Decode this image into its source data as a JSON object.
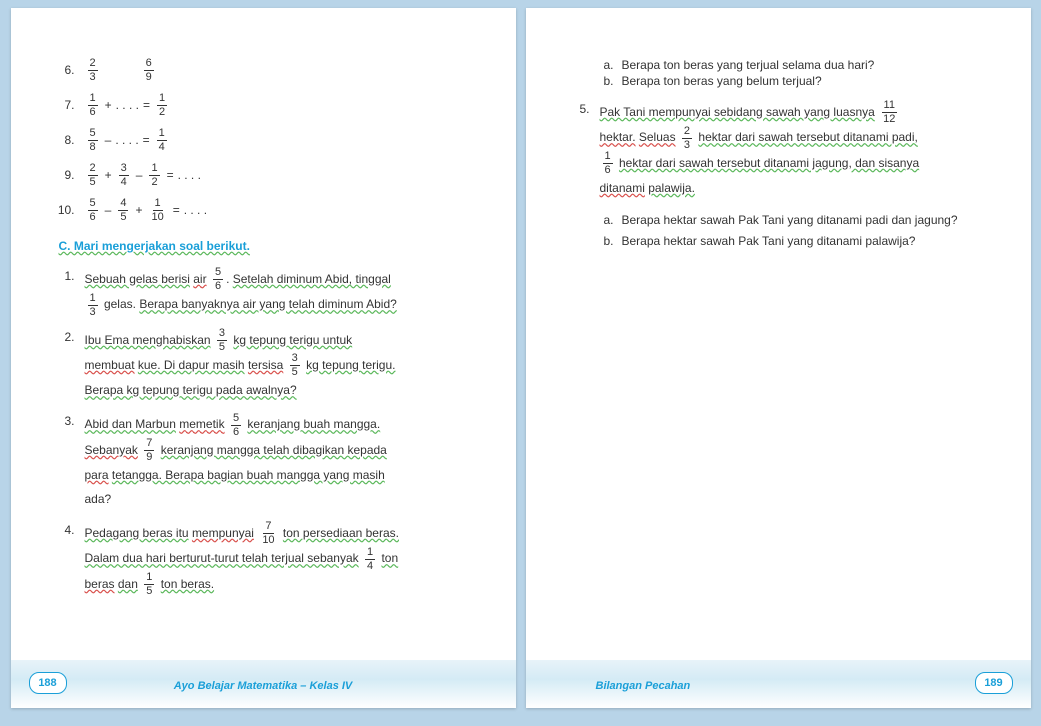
{
  "left": {
    "exercises": [
      {
        "n": "6.",
        "parts": [
          {
            "t": "f",
            "n": "2",
            "d": "3"
          },
          {
            "t": "gap"
          },
          {
            "t": "f",
            "n": "6",
            "d": "9"
          }
        ]
      },
      {
        "n": "7.",
        "parts": [
          {
            "t": "f",
            "n": "1",
            "d": "6"
          },
          {
            "t": "op",
            "v": "+"
          },
          {
            "t": "dots"
          },
          {
            "t": "op",
            "v": "="
          },
          {
            "t": "f",
            "n": "1",
            "d": "2"
          }
        ]
      },
      {
        "n": "8.",
        "parts": [
          {
            "t": "f",
            "n": "5",
            "d": "8"
          },
          {
            "t": "op",
            "v": "–"
          },
          {
            "t": "dots"
          },
          {
            "t": "op",
            "v": "="
          },
          {
            "t": "f",
            "n": "1",
            "d": "4"
          }
        ]
      },
      {
        "n": "9.",
        "parts": [
          {
            "t": "f",
            "n": "2",
            "d": "5"
          },
          {
            "t": "op",
            "v": "+"
          },
          {
            "t": "f",
            "n": "3",
            "d": "4"
          },
          {
            "t": "op",
            "v": "–"
          },
          {
            "t": "f",
            "n": "1",
            "d": "2"
          },
          {
            "t": "op",
            "v": "="
          },
          {
            "t": "dots"
          }
        ]
      },
      {
        "n": "10.",
        "parts": [
          {
            "t": "f",
            "n": "5",
            "d": "6"
          },
          {
            "t": "op",
            "v": "–"
          },
          {
            "t": "f",
            "n": "4",
            "d": "5"
          },
          {
            "t": "op",
            "v": "+"
          },
          {
            "t": "f",
            "n": "1",
            "d": "10"
          },
          {
            "t": "op",
            "v": "="
          },
          {
            "t": "dots"
          }
        ]
      }
    ],
    "sectionTitle": "C.  Mari mengerjakan soal berikut.",
    "word": [
      {
        "n": "1.",
        "html": "<span class='wave-g'>Sebuah gelas berisi</span> <span class='wave'>air</span> <span class='frac'><span class='n'>5</span><span class='d'>6</span></span>. <span class='wave-g'>Setelah diminum Abid, tinggal</span><br><span class='frac'><span class='n'>1</span><span class='d'>3</span></span> gelas. <span class='wave-g'>Berapa banyaknya air yang telah diminum Abid?</span>"
      },
      {
        "n": "2.",
        "html": "<span class='wave-g'>Ibu Ema menghabiskan</span> <span class='frac'><span class='n'>3</span><span class='d'>5</span></span> <span class='wave-g'>kg tepung terigu untuk</span><br><span class='wave'>membuat</span> <span class='wave-g'>kue. Di dapur masih</span> <span class='wave'>tersisa</span> <span class='frac'><span class='n'>3</span><span class='d'>5</span></span> <span class='wave-g'>kg tepung terigu.</span><br><span class='wave-g'>Berapa kg tepung terigu pada awalnya?</span>"
      },
      {
        "n": "3.",
        "html": "<span class='wave-g'>Abid dan Marbun</span> <span class='wave'>memetik</span> <span class='frac'><span class='n'>5</span><span class='d'>6</span></span> <span class='wave-g'>keranjang buah mangga.</span><br><span class='wave'>Sebanyak</span> <span class='frac'><span class='n'>7</span><span class='d'>9</span></span> <span class='wave-g'>keranjang mangga telah dibagikan kepada</span><br><span class='wave'>para</span> <span class='wave-g'>tetangga. Berapa bagian buah mangga yang masih</span><br>ada?"
      },
      {
        "n": "4.",
        "html": "<span class='wave-g'>Pedagang beras itu</span> <span class='wave'>mempunyai</span> <span class='frac'><span class='n'>7</span><span class='d'>10</span></span> <span class='wave-g'>ton persediaan beras.</span><br><span class='wave-g'>Dalam dua hari berturut-turut telah terjual sebanyak</span> <span class='frac'><span class='n'>1</span><span class='d'>4</span></span> <span class='wave-g'>ton</span><br><span class='wave'>beras</span> <span class='wave-g'>dan</span> <span class='frac'><span class='n'>1</span><span class='d'>5</span></span> <span class='wave-g'>ton beras.</span>"
      }
    ],
    "pagenum": "188",
    "footerTitle": "Ayo Belajar Matematika – Kelas IV"
  },
  "right": {
    "cont": [
      {
        "l": "a.",
        "t": "Berapa ton beras yang terjual selama dua hari?"
      },
      {
        "l": "b.",
        "t": "Berapa ton beras yang belum terjual?"
      }
    ],
    "q5": {
      "n": "5.",
      "html": "<span class='wave-g'>Pak Tani mempunyai sebidang sawah yang luasnya</span> <span class='frac'><span class='n'>11</span><span class='d'>12</span></span><br><span class='wave'>hektar.</span> <span class='wave'>Seluas</span> <span class='frac'><span class='n'>2</span><span class='d'>3</span></span> <span class='wave-g'>hektar dari sawah tersebut ditanami padi,</span><br><span class='frac'><span class='n'>1</span><span class='d'>6</span></span> <span class='wave-g'>hektar dari sawah tersebut ditanami jagung, dan sisanya</span><br><span class='wave'>ditanami</span> <span class='wave-g'>palawija.</span>",
      "subs": [
        {
          "l": "a.",
          "t": "Berapa hektar sawah Pak Tani yang ditanami padi dan jagung?"
        },
        {
          "l": "b.",
          "t": "Berapa hektar sawah Pak Tani yang ditanami palawija?"
        }
      ]
    },
    "pagenum": "189",
    "footerTitle": "Bilangan Pecahan"
  }
}
